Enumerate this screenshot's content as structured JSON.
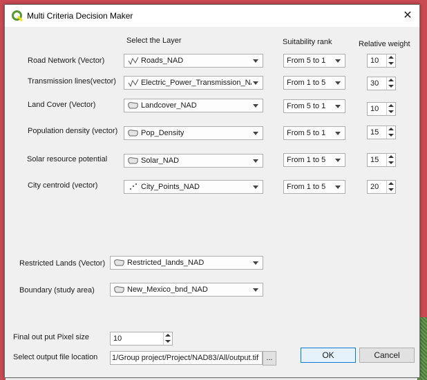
{
  "window": {
    "title": "Multi Criteria Decision Maker",
    "close_glyph": "✕"
  },
  "headers": {
    "layer": "Select the Layer",
    "rank": "Suitability rank",
    "weight": "Relative weight"
  },
  "criteria": [
    {
      "label": "Road Network (Vector)",
      "layer": "Roads_NAD",
      "icon": "line-layer-icon",
      "rank": "From 5 to 1",
      "weight": "10"
    },
    {
      "label": "Transmission lines(vector)",
      "layer": "Electric_Power_Transmission_NAD",
      "icon": "line-layer-icon",
      "rank": "From 1 to 5",
      "weight": "30"
    },
    {
      "label": "Land Cover (Vector)",
      "layer": "Landcover_NAD",
      "icon": "polygon-layer-icon",
      "rank": "From 5 to 1",
      "weight": "10"
    },
    {
      "label": "Population density (vector)",
      "layer": "Pop_Density",
      "icon": "polygon-layer-icon",
      "rank": "From 5 to 1",
      "weight": "15"
    },
    {
      "label": "Solar resource potential",
      "layer": "Solar_NAD",
      "icon": "polygon-layer-icon",
      "rank": "From 1 to 5",
      "weight": "15"
    },
    {
      "label": "City centroid (vector)",
      "layer": "City_Points_NAD",
      "icon": "point-layer-icon",
      "rank": "From 1 to 5",
      "weight": "20"
    }
  ],
  "restricted": {
    "label": "Restricted Lands (Vector)",
    "layer": "Restricted_lands_NAD"
  },
  "boundary": {
    "label": "Boundary (study area)",
    "layer": "New_Mexico_bnd_NAD"
  },
  "pixel": {
    "label": "Final out put Pixel size",
    "value": "10"
  },
  "output": {
    "label": "Select output file location",
    "path": "1/Group project/Project/NAD83/All/output.tif",
    "browse": "..."
  },
  "buttons": {
    "ok": "OK",
    "cancel": "Cancel"
  },
  "colors": {
    "accent": "#0078d7",
    "qgis_green": "#589632",
    "qgis_yellow": "#f0e400"
  }
}
